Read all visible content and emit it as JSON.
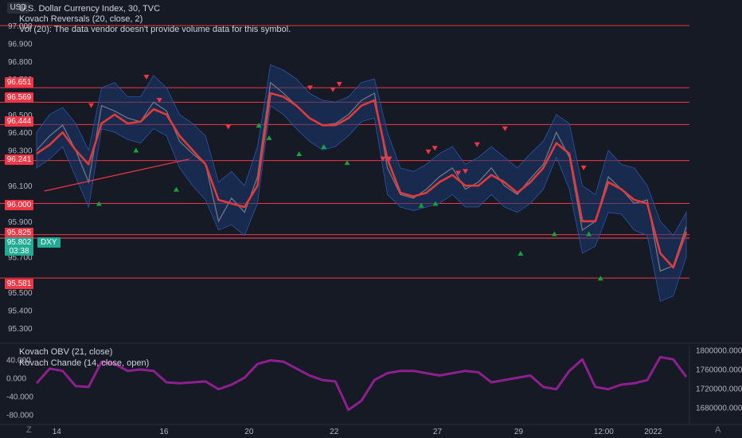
{
  "header": {
    "currency": "USD",
    "title": "U.S. Dollar Currency Index, 30, TVC",
    "indicator1": "Kovach Reversals (20, close, 2)",
    "indicator2": "Vol (20): The data vendor doesn't provide volume data for this symbol."
  },
  "lower_pane": {
    "indicator1": "Kovach OBV (21, close)",
    "indicator2": "Kovach Chande (14, close, open)"
  },
  "price_axis": {
    "ticks": [
      "97.000",
      "96.900",
      "96.800",
      "96.700",
      "96.600",
      "96.500",
      "96.400",
      "96.300",
      "96.100",
      "95.900",
      "95.700",
      "95.500",
      "95.400",
      "95.300"
    ],
    "level_badges": [
      "96.651",
      "96.569",
      "96.444",
      "96.241",
      "96.000",
      "95.825",
      "95.581"
    ],
    "current_price": "95.802",
    "countdown": "03:38",
    "symbol": "DXY"
  },
  "lower_axis": {
    "left_ticks": [
      "40.000",
      "0.000",
      "-40.000",
      "-80.000"
    ],
    "right_ticks": [
      "1800000.000",
      "1760000.000",
      "1720000.000",
      "1680000.000"
    ]
  },
  "time_axis": [
    "14",
    "16",
    "20",
    "22",
    "27",
    "29",
    "12:00",
    "2022"
  ],
  "corner_icons": {
    "left": "Z",
    "right": "A"
  },
  "colors": {
    "background": "#161a25",
    "level_line": "#f23645",
    "price_line": "#787b86",
    "average": "#e03a3a",
    "band_fill": "#1b3a73",
    "marker_up": "#13a33a",
    "marker_down": "#f23645",
    "oscillator": "#8e1f8e",
    "current_badge": "#22ab94"
  },
  "chart_data": [
    {
      "type": "line",
      "x_range": [
        0,
        100
      ],
      "x_ticks": [
        {
          "label": "14",
          "x": 3.1
        },
        {
          "label": "16",
          "x": 19.6
        },
        {
          "label": "20",
          "x": 32.7
        },
        {
          "label": "22",
          "x": 45.8
        },
        {
          "label": "27",
          "x": 61.7
        },
        {
          "label": "29",
          "x": 74.2
        },
        {
          "label": "12:00",
          "x": 87.3
        },
        {
          "label": "2022",
          "x": 94.9
        }
      ],
      "ylim": [
        95.25,
        97.05
      ],
      "y_ticks": [
        97.0,
        96.9,
        96.8,
        96.7,
        96.6,
        96.5,
        96.4,
        96.3,
        96.1,
        95.9,
        95.7,
        95.5,
        95.4,
        95.3
      ],
      "horizontal_levels": [
        97.0,
        96.651,
        96.569,
        96.444,
        96.241,
        96.0,
        95.825,
        95.805,
        95.581
      ],
      "price_x": [
        0,
        2,
        4,
        6,
        8,
        10,
        12,
        14,
        16,
        18,
        20,
        22,
        24,
        26,
        28,
        30,
        32,
        34,
        36,
        38,
        40,
        42,
        44,
        46,
        48,
        50,
        52,
        54,
        56,
        58,
        60,
        62,
        64,
        66,
        68,
        70,
        72,
        74,
        76,
        78,
        80,
        82,
        84,
        86,
        88,
        90,
        92,
        94,
        96,
        98,
        100
      ],
      "price": [
        96.3,
        96.38,
        96.44,
        96.3,
        96.12,
        96.55,
        96.52,
        96.48,
        96.46,
        96.57,
        96.52,
        96.35,
        96.28,
        96.22,
        95.9,
        96.03,
        95.95,
        96.15,
        96.68,
        96.62,
        96.55,
        96.48,
        96.44,
        96.45,
        96.5,
        96.58,
        96.62,
        96.2,
        96.05,
        96.03,
        96.08,
        96.15,
        96.2,
        96.08,
        96.12,
        96.2,
        96.1,
        96.05,
        96.14,
        96.22,
        96.4,
        96.26,
        95.85,
        95.9,
        96.15,
        96.08,
        96.0,
        96.02,
        95.62,
        95.65,
        95.87
      ],
      "band_upper": [
        96.4,
        96.5,
        96.54,
        96.45,
        96.3,
        96.65,
        96.68,
        96.6,
        96.6,
        96.72,
        96.65,
        96.5,
        96.45,
        96.38,
        96.12,
        96.18,
        96.1,
        96.32,
        96.78,
        96.75,
        96.7,
        96.62,
        96.58,
        96.57,
        96.6,
        96.68,
        96.7,
        96.4,
        96.2,
        96.18,
        96.22,
        96.28,
        96.32,
        96.22,
        96.26,
        96.32,
        96.26,
        96.2,
        96.28,
        96.35,
        96.5,
        96.45,
        96.1,
        96.05,
        96.3,
        96.22,
        96.2,
        96.1,
        95.9,
        95.82,
        95.95
      ],
      "band_lower": [
        96.2,
        96.25,
        96.32,
        96.15,
        95.98,
        96.42,
        96.4,
        96.36,
        96.34,
        96.42,
        96.38,
        96.2,
        96.1,
        96.02,
        95.85,
        95.88,
        95.82,
        96.0,
        96.55,
        96.5,
        96.42,
        96.35,
        96.3,
        96.32,
        96.38,
        96.46,
        96.48,
        96.05,
        95.98,
        95.96,
        95.98,
        96.0,
        96.05,
        95.98,
        95.98,
        96.05,
        95.98,
        95.95,
        96.0,
        96.08,
        96.26,
        96.08,
        95.72,
        95.76,
        95.95,
        95.94,
        95.85,
        95.82,
        95.45,
        95.48,
        95.7
      ],
      "moving_average": [
        96.28,
        96.33,
        96.4,
        96.3,
        96.22,
        96.45,
        96.5,
        96.45,
        96.46,
        96.53,
        96.5,
        96.38,
        96.3,
        96.22,
        96.02,
        96.0,
        95.98,
        96.1,
        96.62,
        96.6,
        96.55,
        96.48,
        96.44,
        96.44,
        96.48,
        96.55,
        96.58,
        96.25,
        96.06,
        96.04,
        96.06,
        96.12,
        96.16,
        96.1,
        96.1,
        96.16,
        96.12,
        96.06,
        96.12,
        96.2,
        96.34,
        96.28,
        95.9,
        95.9,
        96.12,
        96.08,
        96.02,
        96.0,
        95.72,
        95.64,
        95.84
      ],
      "trendline": {
        "x": [
          1.2,
          23.5
        ],
        "y": [
          96.07,
          96.25
        ]
      },
      "reversal_down": [
        [
          8.4,
          96.55
        ],
        [
          16.9,
          96.71
        ],
        [
          18.9,
          96.58
        ],
        [
          29.5,
          96.43
        ],
        [
          42.1,
          96.65
        ],
        [
          45.6,
          96.64
        ],
        [
          46.6,
          96.67
        ],
        [
          53.3,
          96.25
        ],
        [
          54.3,
          96.25
        ],
        [
          60.3,
          96.29
        ],
        [
          61.3,
          96.31
        ],
        [
          64.9,
          96.17
        ],
        [
          66.0,
          96.18
        ],
        [
          67.8,
          96.33
        ],
        [
          72.1,
          96.42
        ],
        [
          84.2,
          96.2
        ]
      ],
      "reversal_up": [
        [
          9.6,
          96.0
        ],
        [
          15.3,
          96.3
        ],
        [
          21.5,
          96.08
        ],
        [
          34.2,
          96.44
        ],
        [
          35.8,
          96.37
        ],
        [
          40.4,
          96.28
        ],
        [
          44.2,
          96.32
        ],
        [
          47.8,
          96.23
        ],
        [
          59.2,
          95.99
        ],
        [
          61.4,
          96.0
        ],
        [
          74.5,
          95.72
        ],
        [
          79.7,
          95.83
        ],
        [
          85.0,
          95.83
        ],
        [
          86.8,
          95.58
        ]
      ]
    },
    {
      "type": "line",
      "x_range": [
        0,
        100
      ],
      "ylim": [
        -100,
        70
      ],
      "y_ticks": [
        40,
        0,
        -40,
        -80
      ],
      "y_right_ticks": [
        1800000,
        1760000,
        1720000,
        1680000
      ],
      "x": [
        0,
        2,
        4,
        6,
        8,
        10,
        12,
        14,
        16,
        18,
        20,
        22,
        24,
        26,
        28,
        30,
        32,
        34,
        36,
        38,
        40,
        42,
        44,
        46,
        48,
        50,
        52,
        54,
        56,
        58,
        60,
        62,
        64,
        66,
        68,
        70,
        72,
        74,
        76,
        78,
        80,
        82,
        84,
        86,
        88,
        90,
        92,
        94,
        96,
        98,
        100
      ],
      "values": [
        -12,
        20,
        15,
        -18,
        -20,
        35,
        30,
        15,
        18,
        15,
        -10,
        -12,
        -10,
        -8,
        -25,
        -15,
        0,
        30,
        38,
        35,
        20,
        5,
        -5,
        -8,
        -70,
        -50,
        -5,
        10,
        15,
        15,
        10,
        5,
        10,
        15,
        12,
        -10,
        -5,
        0,
        5,
        -20,
        -25,
        15,
        40,
        -20,
        -25,
        -15,
        -12,
        -5,
        45,
        40,
        2
      ]
    }
  ]
}
